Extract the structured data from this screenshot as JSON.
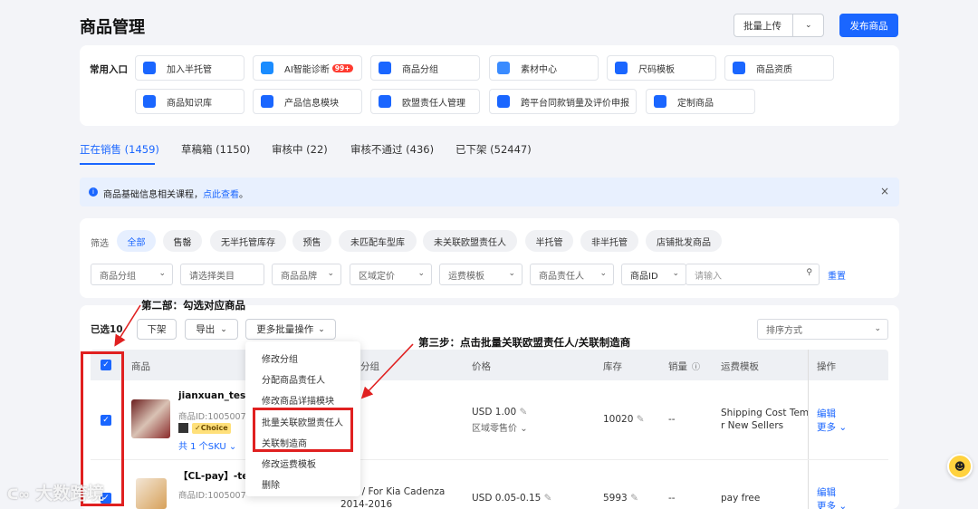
{
  "header": {
    "title": "商品管理",
    "bulk_upload": "批量上传",
    "publish": "发布商品"
  },
  "quick": {
    "label": "常用入口",
    "items": [
      {
        "label": "加入半托管",
        "icon": "half-managed-icon",
        "color": "#1a66ff"
      },
      {
        "label": "AI智能诊断",
        "icon": "ai-robot-icon",
        "color": "#1a8cff",
        "badge": "99+"
      },
      {
        "label": "商品分组",
        "icon": "list-icon",
        "color": "#1a66ff"
      },
      {
        "label": "素材中心",
        "icon": "image-icon",
        "color": "#3a8bff"
      },
      {
        "label": "尺码模板",
        "icon": "size-chart-icon",
        "color": "#1a66ff"
      },
      {
        "label": "商品资质",
        "icon": "certificate-icon",
        "color": "#1a66ff"
      },
      {
        "label": "商品知识库",
        "icon": "book-icon",
        "color": "#1a66ff"
      },
      {
        "label": "产品信息模块",
        "icon": "document-icon",
        "color": "#1a66ff"
      },
      {
        "label": "欧盟责任人管理",
        "icon": "people-icon",
        "color": "#1a66ff"
      },
      {
        "label": "跨平台同款销量及评价申报",
        "icon": "trend-icon",
        "color": "#1a66ff"
      },
      {
        "label": "定制商品",
        "icon": "custom-box-icon",
        "color": "#1a66ff"
      }
    ]
  },
  "tabs": [
    "正在销售 (1459)",
    "草稿箱 (1150)",
    "审核中 (22)",
    "审核不通过 (436)",
    "已下架 (52447)"
  ],
  "notice": {
    "text": "商品基础信息相关课程，",
    "link": "点此查看",
    "end": "。"
  },
  "filter": {
    "label": "筛选",
    "chips": [
      "全部",
      "售罄",
      "无半托管库存",
      "预售",
      "未匹配车型库",
      "未关联欧盟责任人",
      "半托管",
      "非半托管",
      "店铺批发商品"
    ],
    "selects": [
      "商品分组",
      "请选择类目",
      "商品品牌",
      "区域定价",
      "运费模板",
      "商品责任人",
      "商品ID"
    ],
    "search_placeholder": "请输入",
    "reset": "重置"
  },
  "toolbar": {
    "selected": "已选10",
    "delist": "下架",
    "export": "导出",
    "more": "更多批量操作",
    "sort": "排序方式"
  },
  "table": {
    "headers": [
      "商品",
      "分组",
      "价格",
      "库存",
      "销量",
      "运费模板",
      "操作"
    ],
    "rows": [
      {
        "title": "jianxuan_test_",
        "id": "商品ID:1005007",
        "choice": "Choice",
        "sku": "共 1 个SKU",
        "price": "USD 1.00",
        "price_sub": "区域零售价",
        "stock": "10020",
        "sales": "--",
        "shipping": "Shipping Cost Templ",
        "shipping2": "r New Sellers",
        "edit": "编辑",
        "more": "更多"
      },
      {
        "title": "【CL-pay】-test",
        "id": "商品ID:1005007",
        "group": "BAL / For Kia Cadenza",
        "group2": "2014-2016",
        "price": "USD 0.05-0.15",
        "stock": "5993",
        "sales": "--",
        "shipping": "pay free",
        "edit": "编辑",
        "more": "更多"
      }
    ]
  },
  "menu": [
    "修改分组",
    "分配商品责任人",
    "修改商品详描模块",
    "批量关联欧盟责任人",
    "关联制造商",
    "修改运费模板",
    "删除"
  ],
  "annotations": {
    "step2": "第二部：勾选对应商品",
    "step3": "第三步：点击批量关联欧盟责任人/关联制造商"
  },
  "watermark": "大数跨境",
  "colors": {
    "accent": "#1a66ff",
    "annotation": "#e02020"
  }
}
